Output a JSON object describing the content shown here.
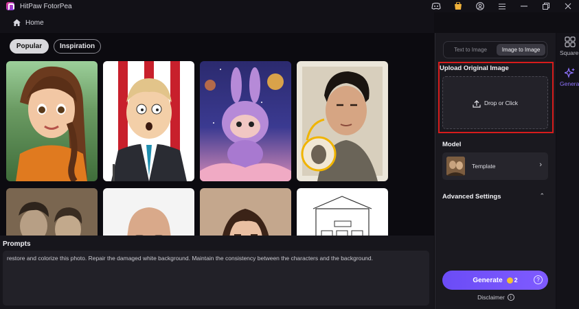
{
  "app": {
    "title": "HitPaw FotorPea"
  },
  "titlebar": {
    "icons": [
      "discord-icon",
      "shop-icon",
      "account-icon",
      "menu-icon",
      "minimize-icon",
      "restore-icon",
      "close-icon"
    ]
  },
  "nav": {
    "home_label": "Home"
  },
  "gallery": {
    "tabs": [
      {
        "label": "Popular",
        "active": true
      },
      {
        "label": "Inspiration",
        "active": false
      }
    ],
    "cards": [
      "cartoon-girl-orange-dress",
      "cartoon-man-suit-podium",
      "purple-toy-space",
      "restored-portrait-man",
      "vintage-couple-photo",
      "bald-man-glasses",
      "woman-portrait",
      "building-sketch"
    ]
  },
  "prompts": {
    "title": "Prompts",
    "text": "restore and colorize this photo. Repair the damaged white background. Maintain the consistency between the characters and the background."
  },
  "panel": {
    "segments": {
      "text_to_image": "Text to Image",
      "image_to_image": "Image to Image",
      "active": "Image to Image"
    },
    "upload": {
      "title": "Upload Original Image",
      "drop_label": "Drop or Click"
    },
    "model": {
      "title": "Model",
      "template_label": "Template"
    },
    "advanced": {
      "title": "Advanced Settings"
    },
    "generate": {
      "label": "Generate",
      "cost": "2"
    },
    "disclaimer": "Disclaimer"
  },
  "rnav": {
    "items": [
      {
        "label": "Square",
        "icon": "grid-icon",
        "active": false
      },
      {
        "label": "Generate",
        "icon": "sparkle-icon",
        "active": true
      }
    ]
  },
  "colors": {
    "accent": "#7356fb",
    "highlight_border": "#d81c1c",
    "coin": "#f2c230"
  }
}
